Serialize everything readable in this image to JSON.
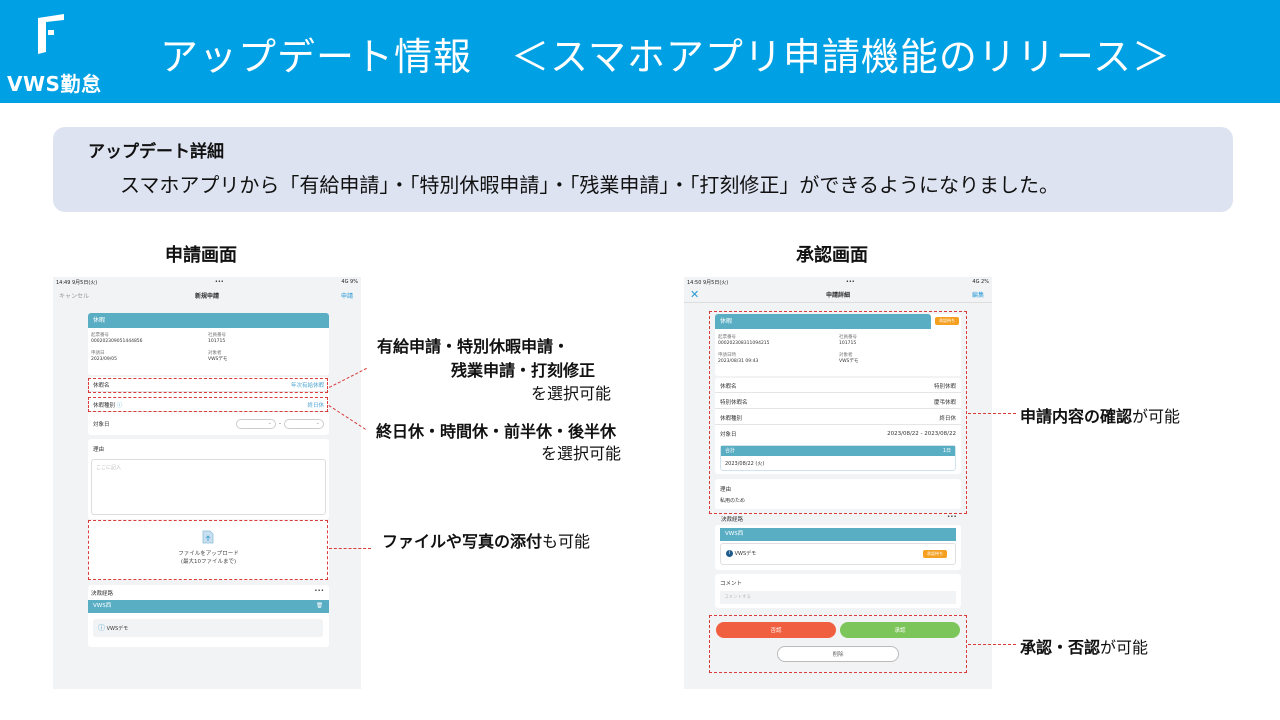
{
  "header": {
    "logo_text": "VWS勤怠",
    "title": "アップデート情報　＜スマホアプリ申請機能のリリース＞"
  },
  "detail": {
    "heading": "アップデート詳細",
    "text": "スマホアプリから「有給申請」・「特別休暇申請」・「残業申請」・「打刻修正」ができるようになりました。"
  },
  "left": {
    "section_title": "申請画面",
    "status_time": "14:49  9月5日(火)",
    "status_dots": "•••",
    "status_right": "4G 9%",
    "nav_cancel": "キャンセル",
    "nav_title": "新規申請",
    "nav_submit": "申請",
    "card_title": "休暇",
    "kv": [
      {
        "label": "起票番号",
        "value": "000202309051444856"
      },
      {
        "label": "社員番号",
        "value": "101715"
      },
      {
        "label": "申請日",
        "value": "2023/09/05"
      },
      {
        "label": "対象者",
        "value": "VWSデモ"
      }
    ],
    "rows": [
      {
        "label": "休暇名",
        "value": "年次有給休暇"
      },
      {
        "label": "休暇種別",
        "value": "終日休"
      },
      {
        "label": "対象日",
        "value": ""
      }
    ],
    "reason_label": "理由",
    "reason_placeholder": "ここに記入",
    "upload_line1": "ファイルをアップロード",
    "upload_line2": "(最大10ファイルまで)",
    "route_label": "決裁経路",
    "route_more": "•••",
    "route_group": "VWS西",
    "route_person": "VWSデモ"
  },
  "right": {
    "section_title": "承認画面",
    "status_time": "14:50  9月5日(火)",
    "status_dots": "•••",
    "status_right": "4G 2%",
    "nav_title": "申請詳細",
    "nav_edit": "編集",
    "card_title": "休暇",
    "card_badge": "承認待ち",
    "kv": [
      {
        "label": "起票番号",
        "value": "000202308311094215"
      },
      {
        "label": "社員番号",
        "value": "101715"
      },
      {
        "label": "申請日時",
        "value": "2023/08/31 09:43"
      },
      {
        "label": "対象者",
        "value": "VWSデモ"
      }
    ],
    "rows": [
      {
        "label": "休暇名",
        "value": "特別休暇"
      },
      {
        "label": "特別休暇名",
        "value": "慶弔休暇"
      },
      {
        "label": "休暇種別",
        "value": "終日休"
      },
      {
        "label": "対象日",
        "value": "2023/08/22 - 2023/08/22"
      }
    ],
    "total_label": "合計",
    "total_value": "1日",
    "total_date": "2023/08/22 (火)",
    "reason_label": "理由",
    "reason_value": "私用のため",
    "route_label": "決裁経路",
    "route_more": "•••",
    "route_group": "VWS西",
    "route_person": "VWSデモ",
    "route_badge": "承認待ち",
    "comment_label": "コメント",
    "comment_placeholder": "コメントする",
    "reject_label": "否認",
    "approve_label": "承認",
    "delete_label": "削除"
  },
  "annotations": {
    "a1_line1": "有給申請・特別休暇申請・",
    "a1_line2": "残業申請・打刻修正",
    "a1_suffix": "を選択可能",
    "a2_line1": "終日休・時間休・前半休・後半休",
    "a2_suffix": "を選択可能",
    "a3_bold": "ファイルや写真の添付",
    "a3_suffix": "も可能",
    "a4_bold": "申請内容の確認",
    "a4_suffix": "が可能",
    "a5_bold": "承認・否認",
    "a5_suffix": "が可能"
  },
  "colors": {
    "header_bg": "#00a1e4",
    "detail_bg": "#dde3f0",
    "card_head": "#5aaec4",
    "reject": "#f06040",
    "approve": "#7cc55a",
    "badge": "#f5a020",
    "dash": "#d93a3a"
  }
}
